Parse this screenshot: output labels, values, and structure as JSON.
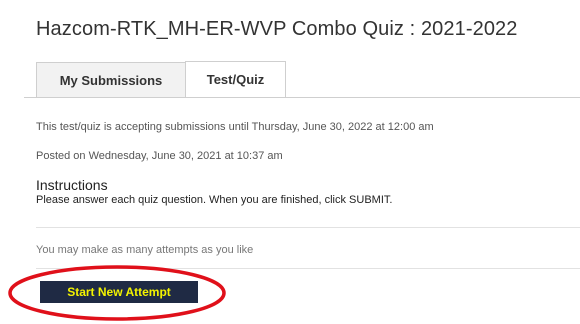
{
  "page": {
    "title": "Hazcom-RTK_MH-ER-WVP Combo Quiz : 2021-2022"
  },
  "tabs": [
    {
      "label": "My Submissions",
      "active": false
    },
    {
      "label": "Test/Quiz",
      "active": true
    }
  ],
  "info": {
    "accepting": "This test/quiz is accepting submissions until Thursday, June 30, 2022 at 12:00 am",
    "posted": "Posted on Wednesday, June 30, 2021 at 10:37 am"
  },
  "instructions": {
    "heading": "Instructions",
    "text": "Please answer each quiz question.  When you are finished, click SUBMIT."
  },
  "attempts": {
    "note": "You may make as many attempts as you like"
  },
  "actions": {
    "start_label": "Start New Attempt"
  },
  "colors": {
    "button_bg": "#1f2a44",
    "button_text": "#f3f300",
    "annotation": "#e0101a"
  }
}
